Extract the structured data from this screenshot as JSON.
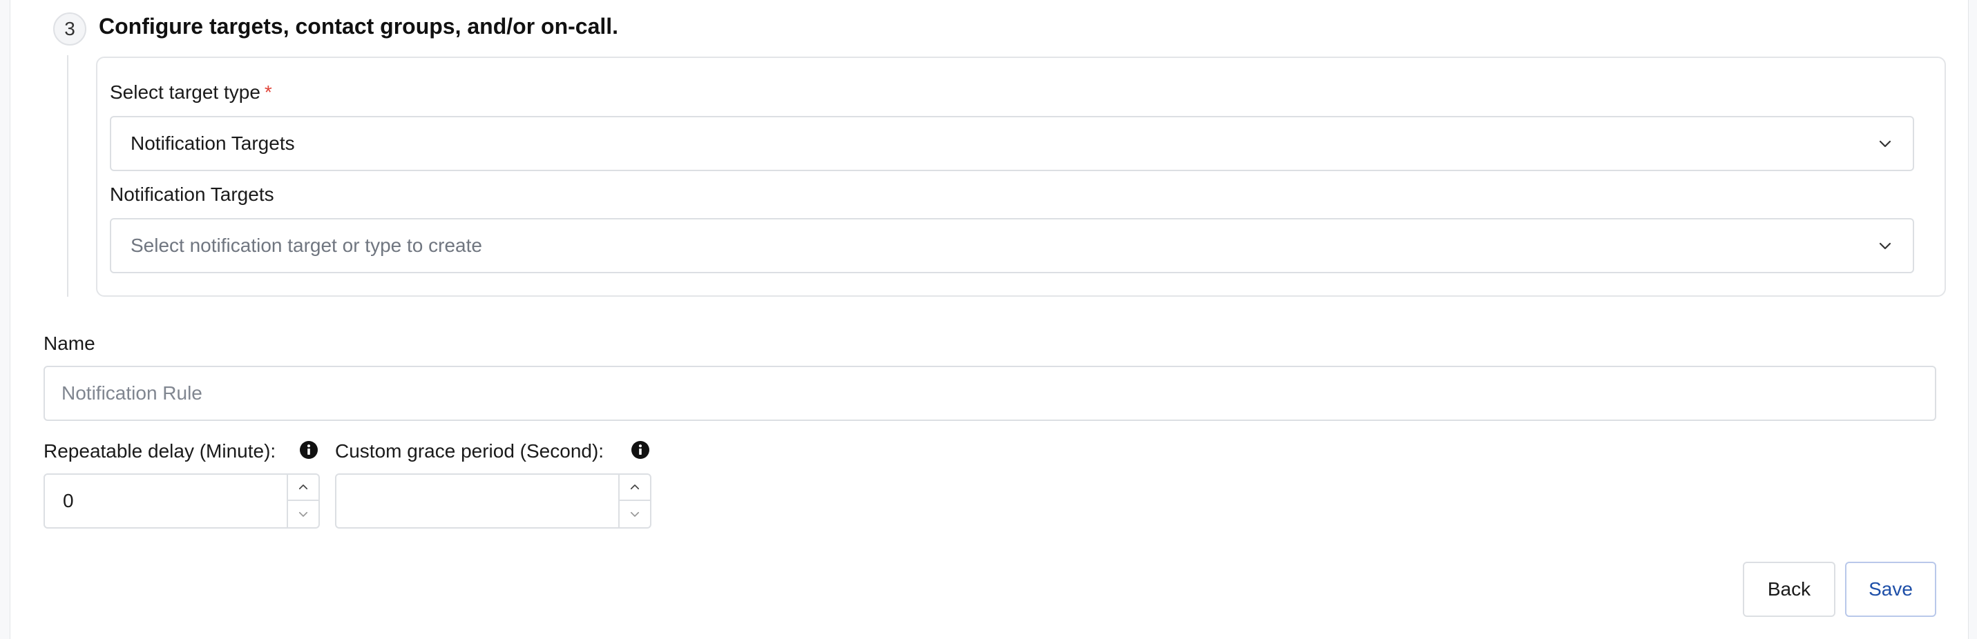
{
  "step": {
    "number": "3",
    "title": "Configure targets, contact groups, and/or on-call."
  },
  "target_type": {
    "label": "Select target type",
    "required_mark": "*",
    "value": "Notification Targets"
  },
  "notification_targets": {
    "label": "Notification Targets",
    "placeholder": "Select notification target or type to create"
  },
  "name": {
    "label": "Name",
    "placeholder": "Notification Rule",
    "value": ""
  },
  "repeatable_delay": {
    "label": "Repeatable delay (Minute):",
    "value": "0"
  },
  "grace_period": {
    "label": "Custom grace period (Second):",
    "value": ""
  },
  "actions": {
    "back_label": "Back",
    "save_label": "Save"
  },
  "colors": {
    "required": "#e0453a",
    "save_text": "#1e4fa8",
    "save_border": "#b9c8ea"
  },
  "icons": [
    "chevron-down-icon",
    "info-icon",
    "chevron-up-icon"
  ]
}
